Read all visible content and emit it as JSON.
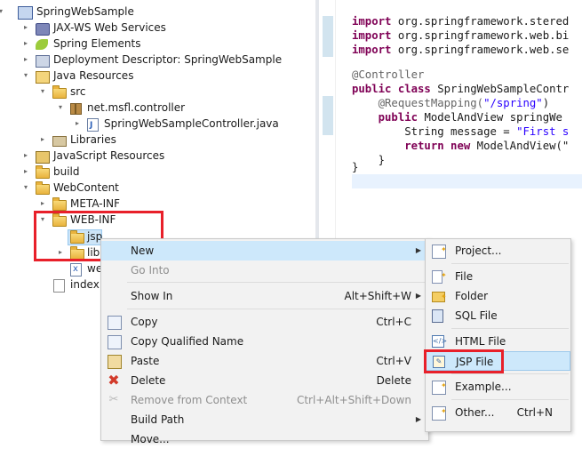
{
  "explorer": {
    "items": [
      {
        "label": "SpringWebSample",
        "twisty": "▾"
      },
      {
        "label": "JAX-WS Web Services",
        "twisty": "▸"
      },
      {
        "label": "Spring Elements",
        "twisty": "▸"
      },
      {
        "label": "Deployment Descriptor: SpringWebSample",
        "twisty": "▸"
      },
      {
        "label": "Java Resources",
        "twisty": "▾"
      },
      {
        "label": "src",
        "twisty": "▾"
      },
      {
        "label": "net.msfl.controller",
        "twisty": "▾"
      },
      {
        "label": "SpringWebSampleController.java",
        "twisty": "▸"
      },
      {
        "label": "Libraries",
        "twisty": "▸"
      },
      {
        "label": "JavaScript Resources",
        "twisty": "▸"
      },
      {
        "label": "build",
        "twisty": "▸"
      },
      {
        "label": "WebContent",
        "twisty": "▾"
      },
      {
        "label": "META-INF",
        "twisty": "▸"
      },
      {
        "label": "WEB-INF",
        "twisty": "▾"
      },
      {
        "label": "jsp",
        "twisty": ""
      },
      {
        "label": "lib",
        "twisty": "▸"
      },
      {
        "label": "we",
        "twisty": ""
      },
      {
        "label": "index.",
        "twisty": ""
      }
    ]
  },
  "editor": {
    "lines": [
      {
        "kw": "import",
        "rest": " org.springframework.stered"
      },
      {
        "kw": "import",
        "rest": " org.springframework.web.bi"
      },
      {
        "kw": "import",
        "rest": " org.springframework.web.se"
      },
      {
        "ann": "@Controller"
      },
      {
        "kw": "public class",
        "rest": " SpringWebSampleContr"
      },
      {
        "ann": "    @RequestMapping(",
        "str": "\"/spring\"",
        "tail": ")"
      },
      {
        "kw": "    public",
        "rest": " ModelAndView springWe"
      },
      {
        "plain": "        String message = ",
        "str": "\"First s"
      },
      {
        "kw": "        return new",
        "rest": " ModelAndView(\""
      },
      {
        "plain": "    }"
      },
      {
        "plain": "}"
      }
    ]
  },
  "context_menu": {
    "items": [
      {
        "label": "New",
        "accel": "",
        "submenu": "▶"
      },
      {
        "label": "Go Into",
        "accel": ""
      },
      {
        "label": "Show In",
        "accel": "Alt+Shift+W",
        "submenu": "▶"
      },
      {
        "label": "Copy",
        "accel": "Ctrl+C"
      },
      {
        "label": "Copy Qualified Name",
        "accel": ""
      },
      {
        "label": "Paste",
        "accel": "Ctrl+V"
      },
      {
        "label": "Delete",
        "accel": "Delete"
      },
      {
        "label": "Remove from Context",
        "accel": "Ctrl+Alt+Shift+Down"
      },
      {
        "label": "Build Path",
        "accel": "",
        "submenu": "▶"
      },
      {
        "label": "Move...",
        "accel": ""
      }
    ]
  },
  "new_submenu": {
    "items": [
      {
        "label": "Project...",
        "accel": ""
      },
      {
        "label": "File",
        "accel": ""
      },
      {
        "label": "Folder",
        "accel": ""
      },
      {
        "label": "SQL File",
        "accel": ""
      },
      {
        "label": "HTML File",
        "accel": ""
      },
      {
        "label": "JSP File",
        "accel": ""
      },
      {
        "label": "Example...",
        "accel": ""
      },
      {
        "label": "Other...",
        "accel": "Ctrl+N"
      }
    ]
  },
  "colors": {
    "highlight_red": "#e8202a",
    "selection_blue": "#cde8fb",
    "keyword": "#7f0055",
    "string": "#2a00ff"
  }
}
